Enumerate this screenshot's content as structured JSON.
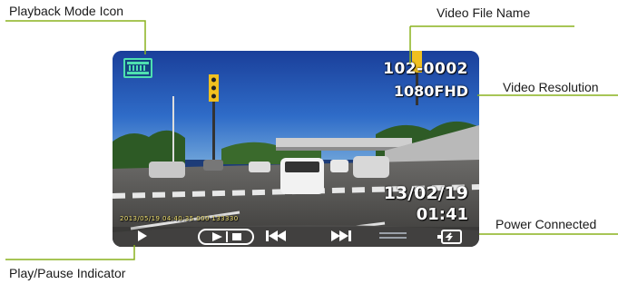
{
  "callouts": {
    "playback_mode_icon": "Playback Mode Icon",
    "video_file_name": "Video File Name",
    "video_resolution": "Video Resolution",
    "power_connected": "Power Connected",
    "play_pause_indicator": "Play/Pause Indicator"
  },
  "screen": {
    "file_name": "102-0002",
    "resolution": "1080FHD",
    "date": "13/02/19",
    "time": "01:41",
    "timestamp_overlay": "2013/05/19 04:40:35 000 133330"
  },
  "icons": {
    "playback_mode": "film-strip-icon",
    "play_pause": "play-icon",
    "play_stop": "play-stop-icon",
    "rewind": "rewind-icon",
    "fast_forward": "fast-forward-icon",
    "volume": "volume-bars-icon",
    "power": "power-plug-icon"
  },
  "colors": {
    "callout_line": "#8ab21e",
    "mode_icon": "#4ee0b0",
    "osd_text": "#ffffff",
    "stamp_text": "#f0e070"
  }
}
